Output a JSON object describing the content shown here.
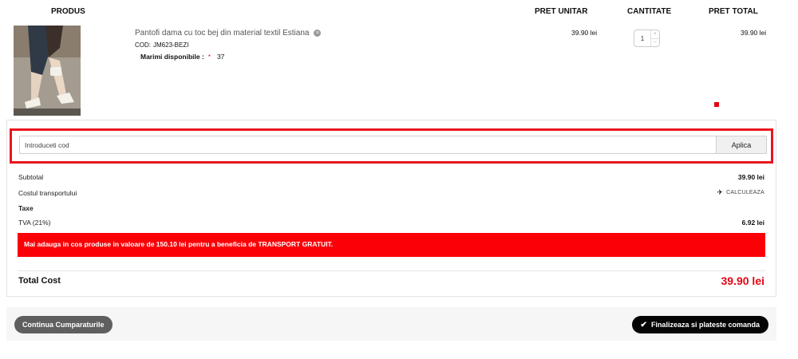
{
  "table_header": {
    "product": "PRODUS",
    "unit_price": "PRET UNITAR",
    "quantity": "CANTITATE",
    "total_price": "PRET TOTAL"
  },
  "item": {
    "name": "Pantofi dama cu toc bej din material textil Estiana",
    "remove_icon": "×",
    "code_label": "COD:",
    "code": "JM623-BEZI",
    "sizes_label": "Marimi disponibile :",
    "sizes_marker": "*",
    "size": "37",
    "unit_price": "39.90 lei",
    "quantity": "1",
    "qty_up": "+",
    "qty_down": "−",
    "total_price": "39.90 lei"
  },
  "coupon": {
    "placeholder": "Introduceti cod",
    "apply_label": "Aplica"
  },
  "summary": {
    "subtotal_label": "Subtotal",
    "subtotal_value": "39.90 lei",
    "shipping_label": "Costul transportului",
    "shipping_action": "CALCULEAZA",
    "shipping_icon": "✈",
    "taxes_label": "Taxe",
    "tva_label": "TVA (21%)",
    "tva_value": "6.92 lei",
    "free_shipping_msg": "Mai adauga in cos produse in valoare de 150.10 lei pentru a beneficia de TRANSPORT GRATUIT.",
    "total_label": "Total Cost",
    "total_value": "39.90 lei"
  },
  "actions": {
    "continue_label": "Continua Cumparaturile",
    "checkout_icon": "✔",
    "checkout_label": "Finalizeaza si plateste comanda"
  },
  "colors": {
    "accent_red": "#e30613",
    "banner_red": "#fb0007",
    "dark_button": "#050505",
    "grey_button": "#5f5f5f"
  }
}
